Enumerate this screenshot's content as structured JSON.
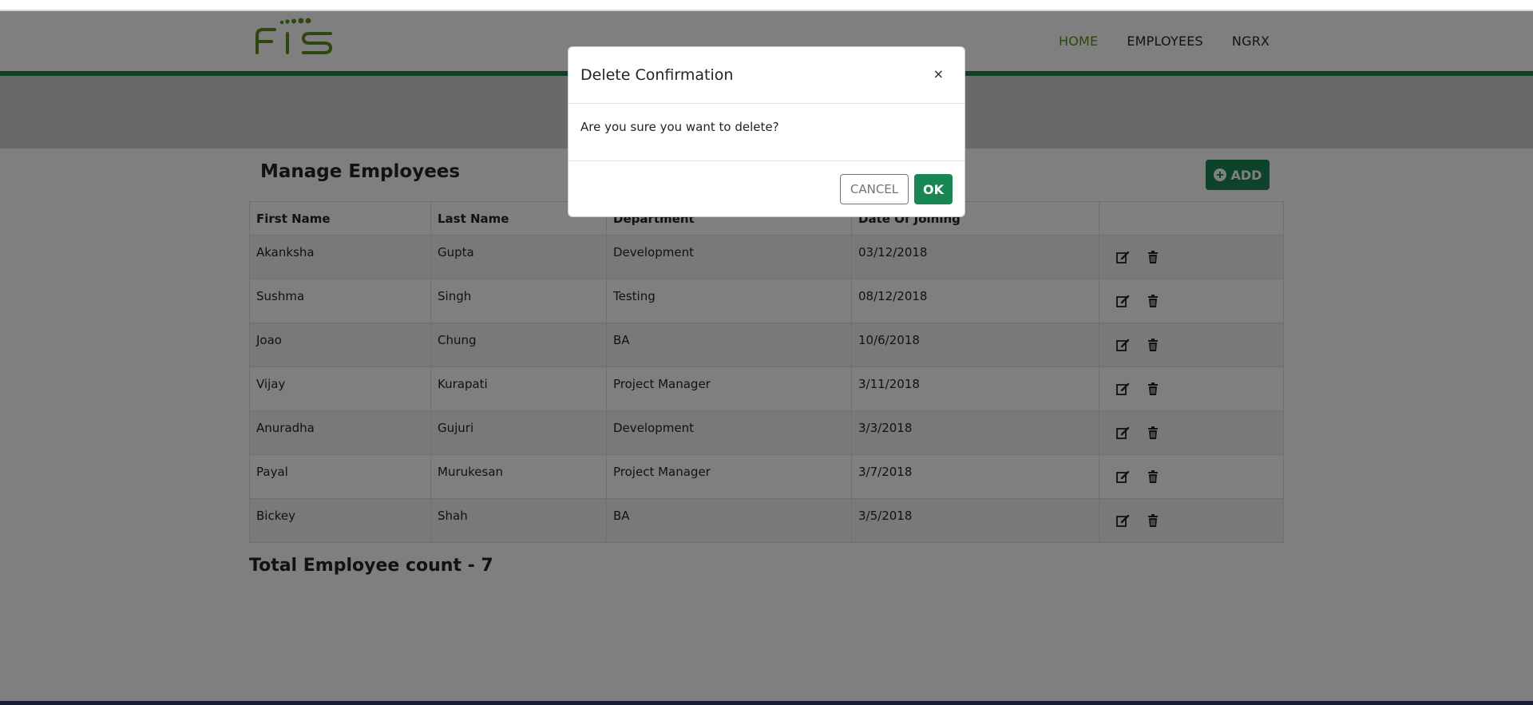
{
  "nav": {
    "items": [
      {
        "label": "HOME",
        "active": true
      },
      {
        "label": "EMPLOYEES",
        "active": false
      },
      {
        "label": "NGRX",
        "active": false
      }
    ]
  },
  "logo": {
    "text": "FIS",
    "color": "#5a8f1f"
  },
  "page": {
    "title": "Manage Employees",
    "add_label": "ADD",
    "total_label": "Total Employee count - 7"
  },
  "table": {
    "headers": [
      "First Name",
      "Last Name",
      "Department",
      "Date Of Joining",
      ""
    ],
    "rows": [
      [
        "Akanksha",
        "Gupta",
        "Development",
        "03/12/2018"
      ],
      [
        "Sushma",
        "Singh",
        "Testing",
        "08/12/2018"
      ],
      [
        "Joao",
        "Chung",
        "BA",
        "10/6/2018"
      ],
      [
        "Vijay",
        "Kurapati",
        "Project Manager",
        "3/11/2018"
      ],
      [
        "Anuradha",
        "Gujuri",
        "Development",
        "3/3/2018"
      ],
      [
        "Payal",
        "Murukesan",
        "Project Manager",
        "3/7/2018"
      ],
      [
        "Bickey",
        "Shah",
        "BA",
        "3/5/2018"
      ]
    ],
    "row_icons": [
      "edit-icon",
      "trash-icon"
    ]
  },
  "modal": {
    "title": "Delete Confirmation",
    "close_label": "×",
    "message": "Are you sure you want to delete?",
    "cancel_label": "CANCEL",
    "ok_label": "OK"
  },
  "colors": {
    "primary_green": "#198754",
    "nav_active": "#5a8f1f",
    "header_rule": "#1e8449"
  }
}
